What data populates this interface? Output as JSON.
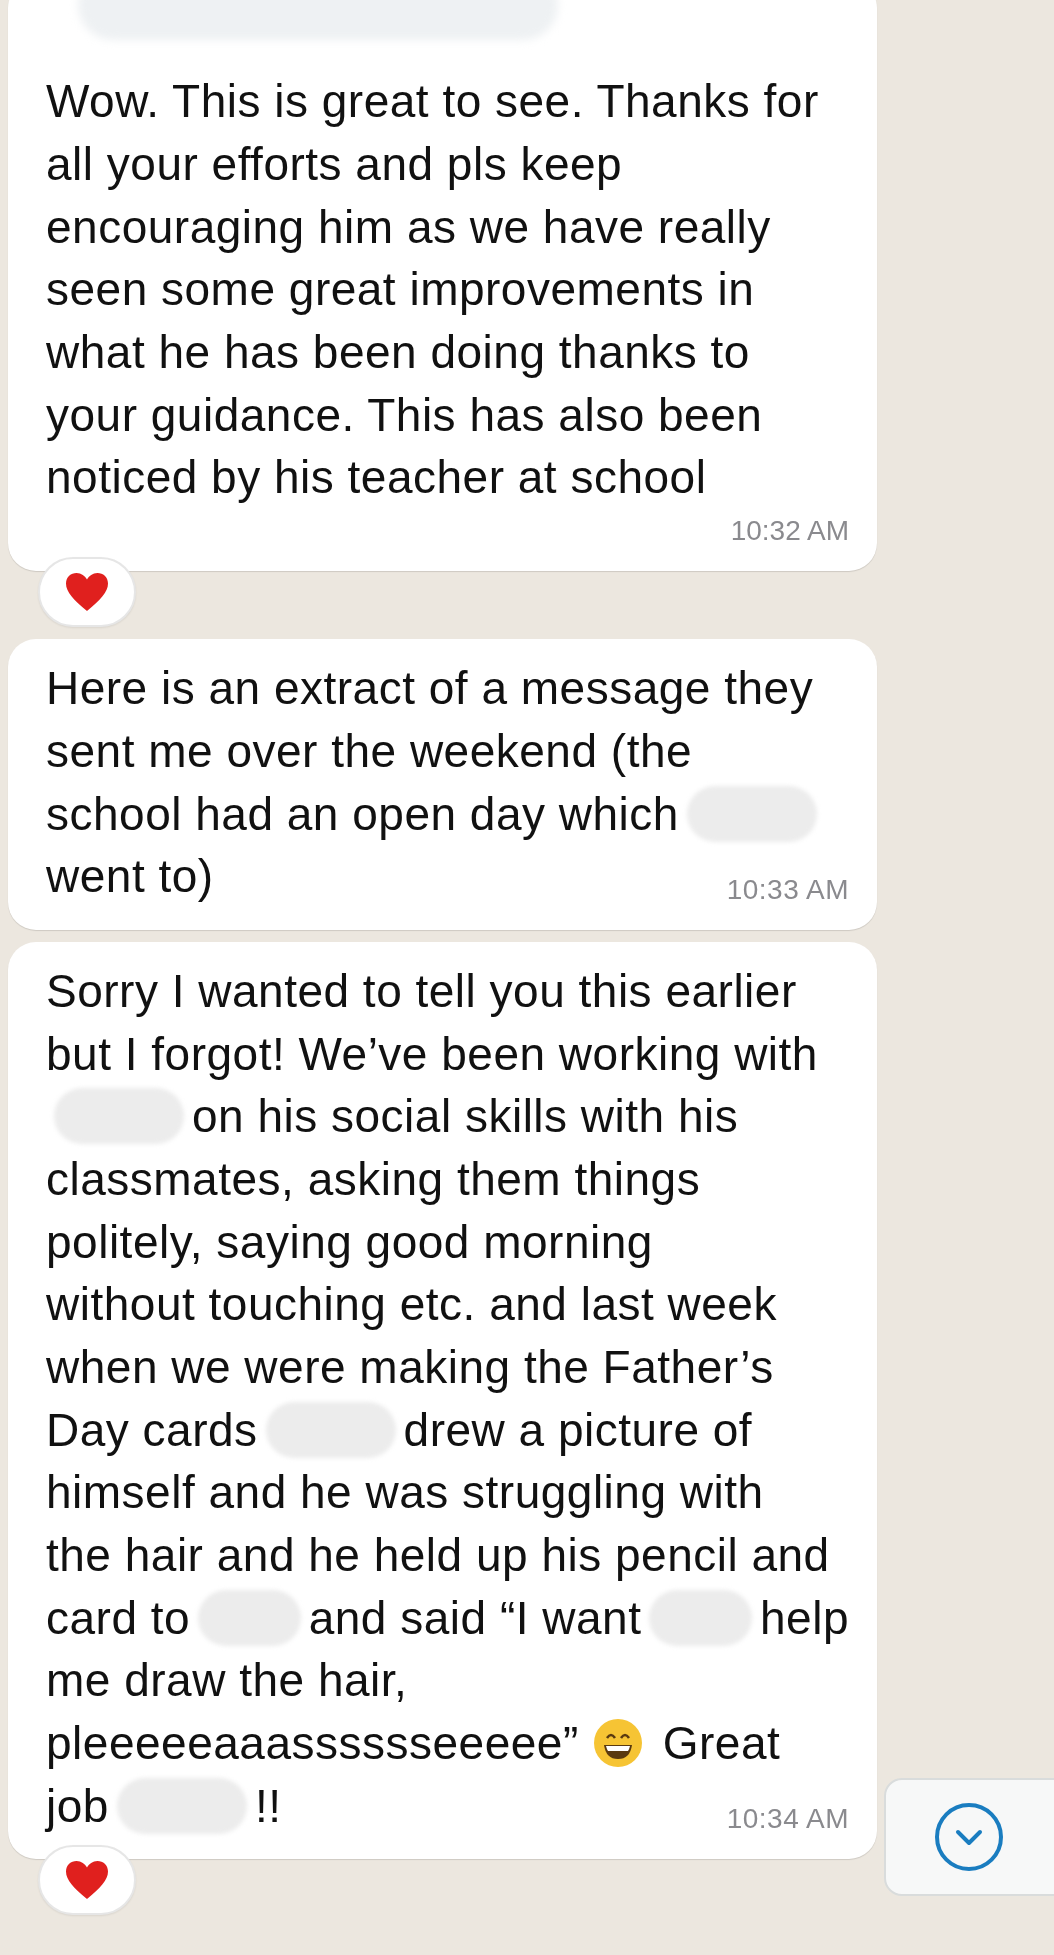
{
  "messages": [
    {
      "sender_redacted": true,
      "lines": [
        [
          {
            "kind": "text",
            "text": "Wow. This is great to see. Thanks for"
          }
        ],
        [
          {
            "kind": "text",
            "text": "all your efforts and pls keep"
          }
        ],
        [
          {
            "kind": "text",
            "text": "encouraging him as we have really"
          }
        ],
        [
          {
            "kind": "text",
            "text": "seen some great improvements in"
          }
        ],
        [
          {
            "kind": "text",
            "text": "what he has been doing thanks to"
          }
        ],
        [
          {
            "kind": "text",
            "text": "your guidance. This has also been"
          }
        ],
        [
          {
            "kind": "text",
            "text": "noticed by his teacher at school"
          }
        ]
      ],
      "time": "10:32 AM",
      "heart_reaction": true
    },
    {
      "sender_redacted": false,
      "lines": [
        [
          {
            "kind": "text",
            "text": "Here is an extract of a message they"
          }
        ],
        [
          {
            "kind": "text",
            "text": "sent me over the weekend (the"
          }
        ],
        [
          {
            "kind": "text",
            "text": "school had an open day which"
          },
          {
            "kind": "redacted"
          }
        ],
        [
          {
            "kind": "text",
            "text": "went to)"
          }
        ]
      ],
      "time": "10:33 AM",
      "heart_reaction": false
    },
    {
      "sender_redacted": false,
      "lines": [
        [
          {
            "kind": "text",
            "text": "Sorry I wanted to tell you this earlier"
          }
        ],
        [
          {
            "kind": "text",
            "text": "but I forgot! We’ve been working with"
          }
        ],
        [
          {
            "kind": "redacted"
          },
          {
            "kind": "text",
            "text": "on his social skills with his"
          }
        ],
        [
          {
            "kind": "text",
            "text": "classmates, asking them things"
          }
        ],
        [
          {
            "kind": "text",
            "text": "politely, saying good morning"
          }
        ],
        [
          {
            "kind": "text",
            "text": "without touching etc. and last week"
          }
        ],
        [
          {
            "kind": "text",
            "text": "when we were making the Father’s"
          }
        ],
        [
          {
            "kind": "text",
            "text": "Day cards"
          },
          {
            "kind": "redacted"
          },
          {
            "kind": "text",
            "text": "drew a picture of"
          }
        ],
        [
          {
            "kind": "text",
            "text": "himself and he was struggling with"
          }
        ],
        [
          {
            "kind": "text",
            "text": "the hair and he held up his pencil and"
          }
        ],
        [
          {
            "kind": "text",
            "text": "card to"
          },
          {
            "kind": "redacted"
          },
          {
            "kind": "text",
            "text": "and said “I want"
          },
          {
            "kind": "redacted"
          },
          {
            "kind": "text",
            "text": "help"
          }
        ],
        [
          {
            "kind": "text",
            "text": "me draw the hair,"
          }
        ],
        [
          {
            "kind": "text",
            "text": "pleeeeeaaasssssseeeee”"
          },
          {
            "kind": "emoji"
          },
          {
            "kind": "text",
            "text": "Great"
          }
        ],
        [
          {
            "kind": "text",
            "text": "job"
          },
          {
            "kind": "redacted"
          },
          {
            "kind": "text",
            "text": "!!"
          }
        ]
      ],
      "time": "10:34 AM",
      "heart_reaction": true
    }
  ],
  "scroll_down_button": true
}
